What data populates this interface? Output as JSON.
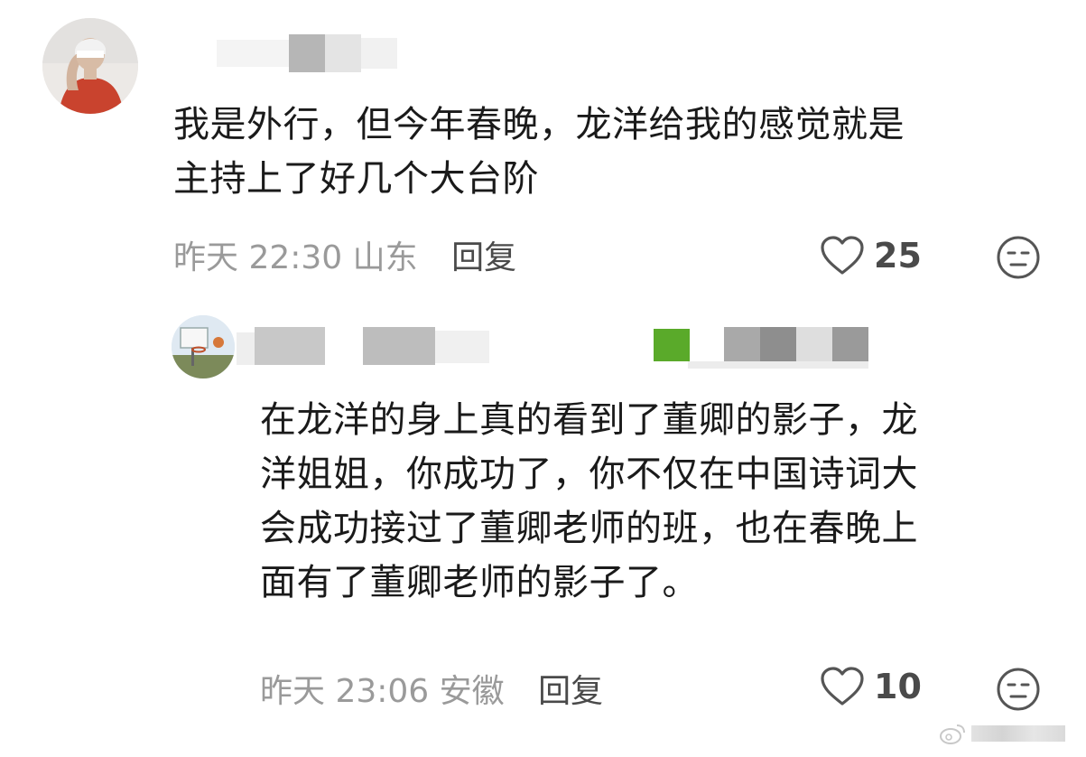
{
  "comments": [
    {
      "text_lines": [
        "我是外行，但今年春晚，龙洋给我的感觉就是",
        "主持上了好几个大台阶"
      ],
      "time": "昨天 22:30",
      "location": "山东",
      "reply_label": "回复",
      "likes": "25",
      "avatar_icon": "user-avatar-photo"
    },
    {
      "text_lines": [
        "在龙洋的身上真的看到了董卿的影子，龙",
        "洋姐姐，你成功了，你不仅在中国诗词大",
        "会成功接过了董卿老师的班，也在春晚上",
        "面有了董卿老师的影子了。"
      ],
      "time": "昨天 23:06",
      "location": "安徽",
      "reply_label": "回复",
      "likes": "10",
      "avatar_icon": "basketball-hoop-avatar"
    }
  ],
  "icons": {
    "like": "heart-outline-icon",
    "dislike": "unamused-face-icon",
    "watermark": "weibo-watermark"
  },
  "colors": {
    "text": "#1a1a1a",
    "meta": "#9a9a9a",
    "reply": "#4a4a4a",
    "badge_green": "#5aaa2a"
  }
}
